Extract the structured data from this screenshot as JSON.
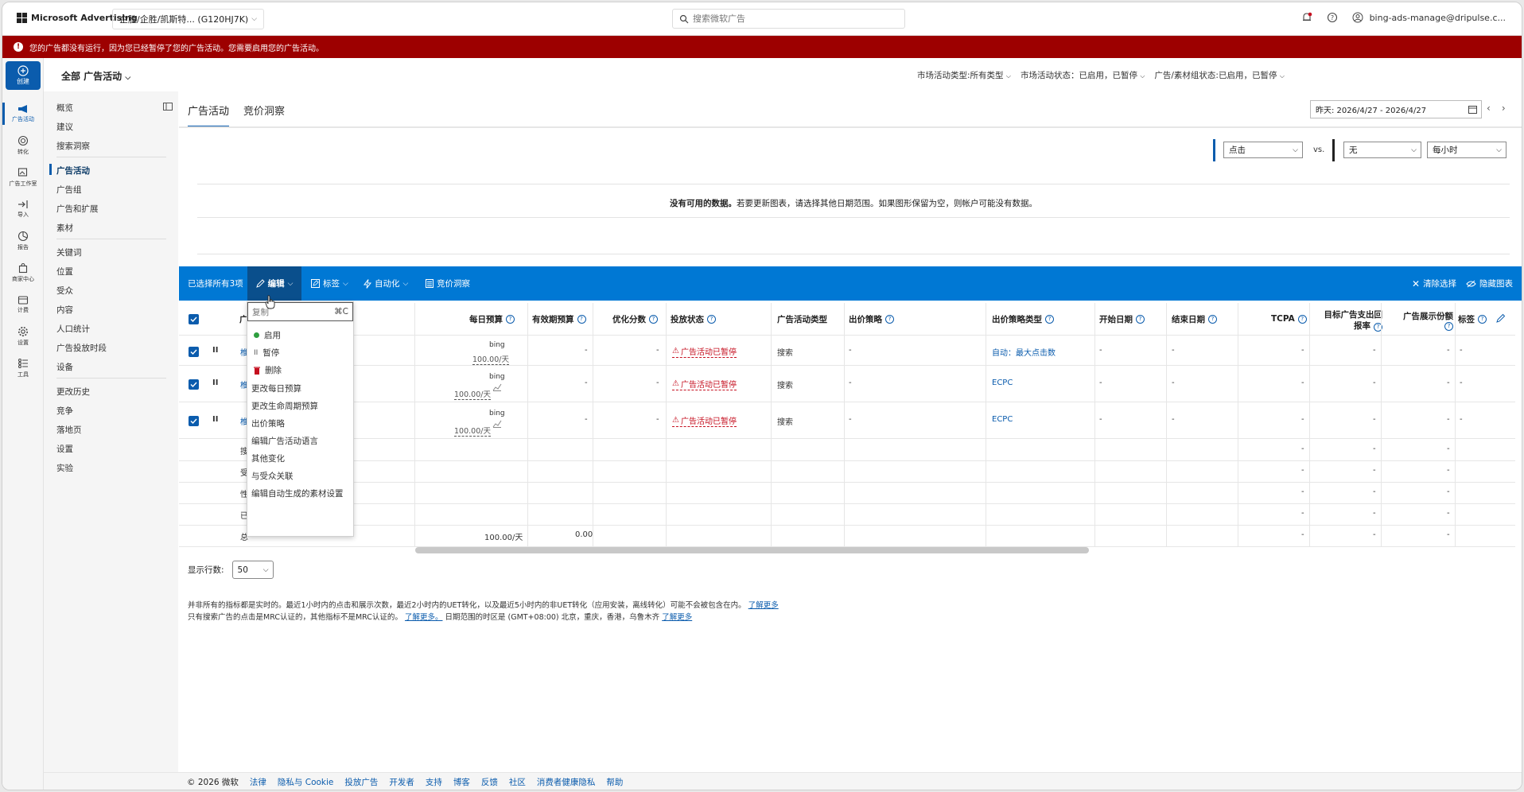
{
  "header": {
    "brand": "Microsoft Advertising",
    "account": "企胜/企胜/凯斯特... (G120HJ7K)",
    "search_placeholder": "搜索微软广告",
    "user_email": "bing-ads-manage@dripulse.c..."
  },
  "alert": {
    "text": "您的广告都没有运行，因为您已经暂停了您的广告活动。您需要启用您的广告活动。"
  },
  "rail": {
    "create": "创建",
    "items": [
      "广告活动",
      "转化",
      "广告工作室",
      "导入",
      "报告",
      "商家中心",
      "计费",
      "设置",
      "工具"
    ]
  },
  "scope": {
    "all_campaigns": "全部 广告活动"
  },
  "nav": {
    "group1": [
      "概览",
      "建议",
      "搜索洞察"
    ],
    "group2": [
      "广告活动",
      "广告组",
      "广告和扩展",
      "素材"
    ],
    "group3": [
      "关键词",
      "位置",
      "受众",
      "内容",
      "人口统计",
      "广告投放时段",
      "设备"
    ],
    "group4": [
      "更改历史",
      "竞争",
      "落地页",
      "设置",
      "实验"
    ]
  },
  "filters": {
    "type": "市场活动类型:所有类型",
    "status": "市场活动状态：已启用，已暂停",
    "group_status": "广告/素材组状态:已启用，已暂停"
  },
  "tabs": [
    "广告活动",
    "竞价洞察"
  ],
  "date_range": "昨天: 2026/4/27 - 2026/4/27",
  "chart": {
    "metric1": "点击",
    "vs": "vs.",
    "metric2": "无",
    "granularity": "每小时",
    "no_data_bold": "没有可用的数据。",
    "no_data_rest": "若要更新图表，请选择其他日期范围。如果图形保留为空，则帐户可能没有数据。"
  },
  "actionbar": {
    "selected": "已选择所有3项",
    "edit": "编辑",
    "labels": "标签",
    "automate": "自动化",
    "auction": "竞价洞察",
    "clear": "清除选择",
    "hide_chart": "隐藏图表"
  },
  "columns": {
    "campaign": "广",
    "daily_budget": "每日预算",
    "valid_budget": "有效期预算",
    "opt_score": "优化分数",
    "delivery": "投放状态",
    "type": "广告活动类型",
    "bid_strategy": "出价策略",
    "bid_strategy_type": "出价策略类型",
    "start": "开始日期",
    "end": "结束日期",
    "tcpa": "TCPA",
    "target_roas_1": "目标广告支出回",
    "target_roas_2": "报率",
    "impr_share_1": "广告展示份额",
    "labels": "标签"
  },
  "rows": [
    {
      "name": "椎",
      "budget_src": "bing",
      "budget": "100.00/天",
      "valid": "-",
      "opt": "-",
      "delivery": "广告活动已暂停",
      "type": "搜索",
      "bid": "-",
      "bid_type": "自动：最大点击数",
      "start": "-",
      "end": "-",
      "tcpa": "-",
      "roas": "-",
      "share": "-",
      "label": "-"
    },
    {
      "name": "椎",
      "budget_src": "bing",
      "budget": "100.00/天",
      "valid": "-",
      "opt": "-",
      "delivery": "广告活动已暂停",
      "type": "搜索",
      "bid": "-",
      "bid_type": "ECPC",
      "start": "-",
      "end": "-",
      "tcpa": "-",
      "roas": "-",
      "share": "-",
      "label": "-"
    },
    {
      "name": "椎",
      "budget_src": "bing",
      "budget": "100.00/天",
      "valid": "-",
      "opt": "-",
      "delivery": "广告活动已暂停",
      "type": "搜索",
      "bid": "-",
      "bid_type": "ECPC",
      "start": "-",
      "end": "-",
      "tcpa": "-",
      "roas": "-",
      "share": "-",
      "label": "-"
    }
  ],
  "summary_rows": [
    {
      "label": "搜",
      "tcpa": "-",
      "roas": "-",
      "share": "-"
    },
    {
      "label": "受",
      "tcpa": "-",
      "roas": "-",
      "share": "-"
    },
    {
      "label": "性",
      "tcpa": "-",
      "roas": "-",
      "share": "-"
    },
    {
      "label": "已",
      "tcpa": "-",
      "roas": "-",
      "share": "-"
    },
    {
      "label": "总",
      "budget": "100.00/天",
      "valid": "0.00",
      "tcpa": "-",
      "roas": "-",
      "share": "-"
    }
  ],
  "menu": {
    "copy": "复制",
    "copy_shortcut": "⌘C",
    "enable": "启用",
    "pause": "暂停",
    "delete": "删除",
    "items": [
      "更改每日预算",
      "更改生命周期预算",
      "出价策略",
      "编辑广告活动语言",
      "其他变化",
      "与受众关联",
      "编辑自动生成的素材设置"
    ]
  },
  "rows_select": {
    "label": "显示行数:",
    "value": "50"
  },
  "notes": {
    "line1": "并非所有的指标都是实时的。最近1小时内的点击和展示次数，最近2小时内的UET转化，以及最近5小时内的非UET转化（应用安装，离线转化）可能不会被包含在内。",
    "line1_link": "了解更多",
    "line2": "只有搜索广告的点击是MRC认证的，其他指标不是MRC认证的。",
    "line2_link": "了解更多。",
    "line2_rest": "日期范围的时区是 (GMT+08:00) 北京，重庆，香港，乌鲁木齐",
    "line2_link2": "了解更多"
  },
  "footer": {
    "copyright": "© 2026 微软",
    "links": [
      "法律",
      "隐私与 Cookie",
      "投放广告",
      "开发者",
      "支持",
      "博客",
      "反馈",
      "社区",
      "消费者健康隐私",
      "帮助"
    ]
  },
  "colors": {
    "brand_blue": "#0b5cad",
    "action_blue": "#0078d4",
    "alert_red": "#9d0000",
    "paused_red": "#c50f1f"
  }
}
